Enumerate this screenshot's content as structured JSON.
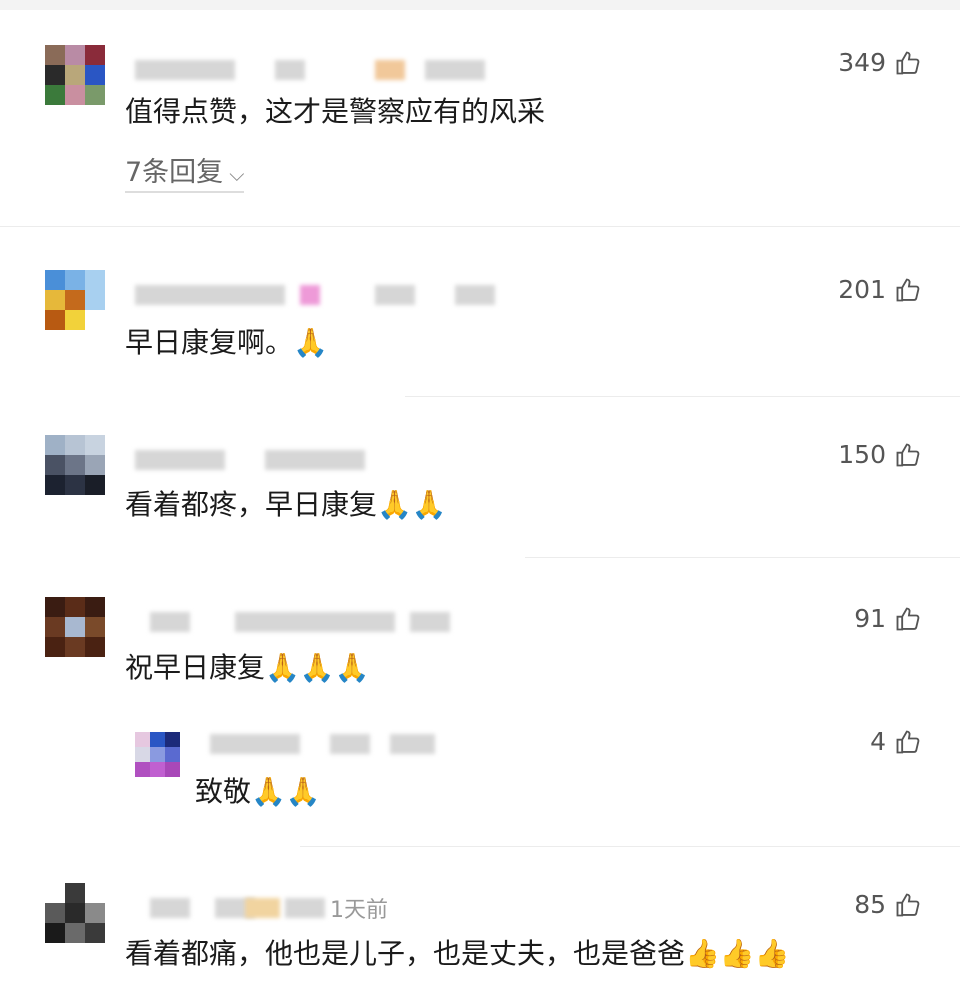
{
  "comments": [
    {
      "text": "值得点赞，这才是警察应有的风采",
      "likes": "349",
      "replies": "7条回复"
    },
    {
      "text": "早日康复啊。🙏",
      "likes": "201"
    },
    {
      "text": "看着都疼，早日康复🙏🙏",
      "likes": "150"
    },
    {
      "text": "祝早日康复🙏🙏🙏",
      "likes": "91",
      "reply": {
        "text": "致敬🙏🙏",
        "likes": "4"
      }
    },
    {
      "text": "看着都痛，他也是儿子，也是丈夫，也是爸爸👍👍👍",
      "likes": "85",
      "timestamp": "1天前"
    }
  ],
  "icons": {
    "like": "thumbs-up-outline-icon",
    "expand": "chevron-down-icon"
  }
}
